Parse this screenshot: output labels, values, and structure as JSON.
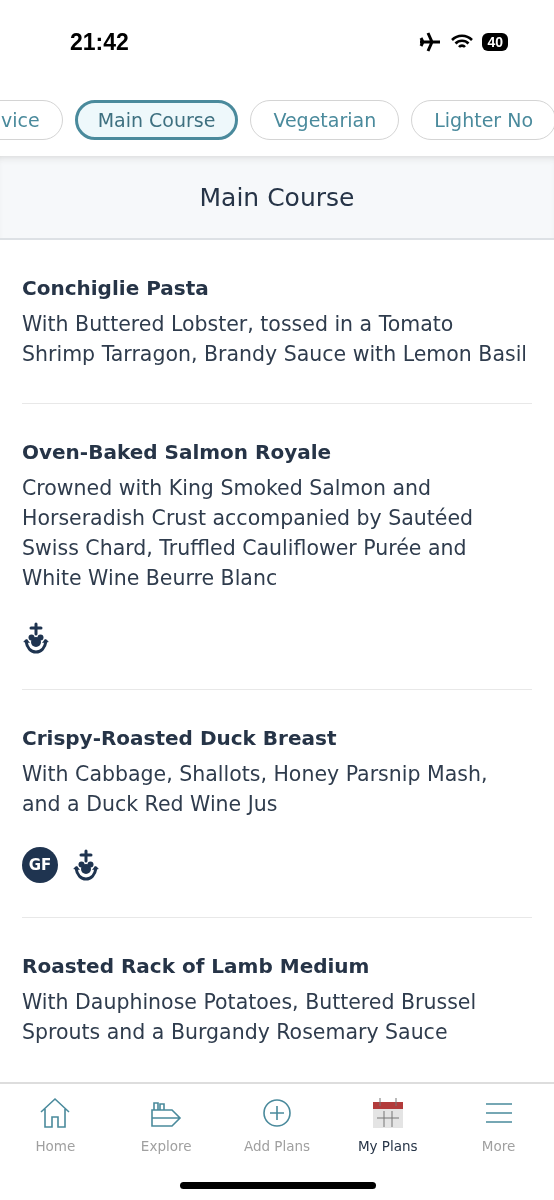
{
  "status_bar": {
    "time": "21:42",
    "battery": "40"
  },
  "chips": [
    {
      "label": "vice",
      "selected": false
    },
    {
      "label": "Main Course",
      "selected": true
    },
    {
      "label": "Vegetarian",
      "selected": false
    },
    {
      "label": "Lighter No",
      "selected": false
    }
  ],
  "section": {
    "title": "Main Course"
  },
  "dishes": [
    {
      "name": "Conchiglie Pasta",
      "description": "With Buttered Lobster, tossed in a Tomato Shrimp Tarragon, Brandy Sauce with Lemon Basil"
    },
    {
      "name": "Oven-Baked Salmon Royale",
      "description": "Crowned with King Smoked Salmon and Horseradish Crust accompanied by Sautéed Swiss Chard, Truffled Cauliflower Purée and White Wine Beurre Blanc",
      "tags": [
        {
          "kind": "icon"
        }
      ]
    },
    {
      "name": "Crispy-Roasted Duck Breast",
      "description": "With Cabbage, Shallots, Honey Parsnip Mash, and a Duck Red Wine Jus",
      "tags": [
        {
          "kind": "badge",
          "text": "GF"
        },
        {
          "kind": "icon"
        }
      ]
    },
    {
      "name": "Roasted Rack of Lamb Medium",
      "description": "With Dauphinose Potatoes, Buttered Brussel Sprouts and a Burgandy Rosemary Sauce"
    }
  ],
  "tab_bar": [
    {
      "label": "Home",
      "selected": false
    },
    {
      "label": "Explore",
      "selected": false
    },
    {
      "label": "Add Plans",
      "selected": false
    },
    {
      "label": "My Plans",
      "selected": true
    },
    {
      "label": "More",
      "selected": false
    }
  ]
}
